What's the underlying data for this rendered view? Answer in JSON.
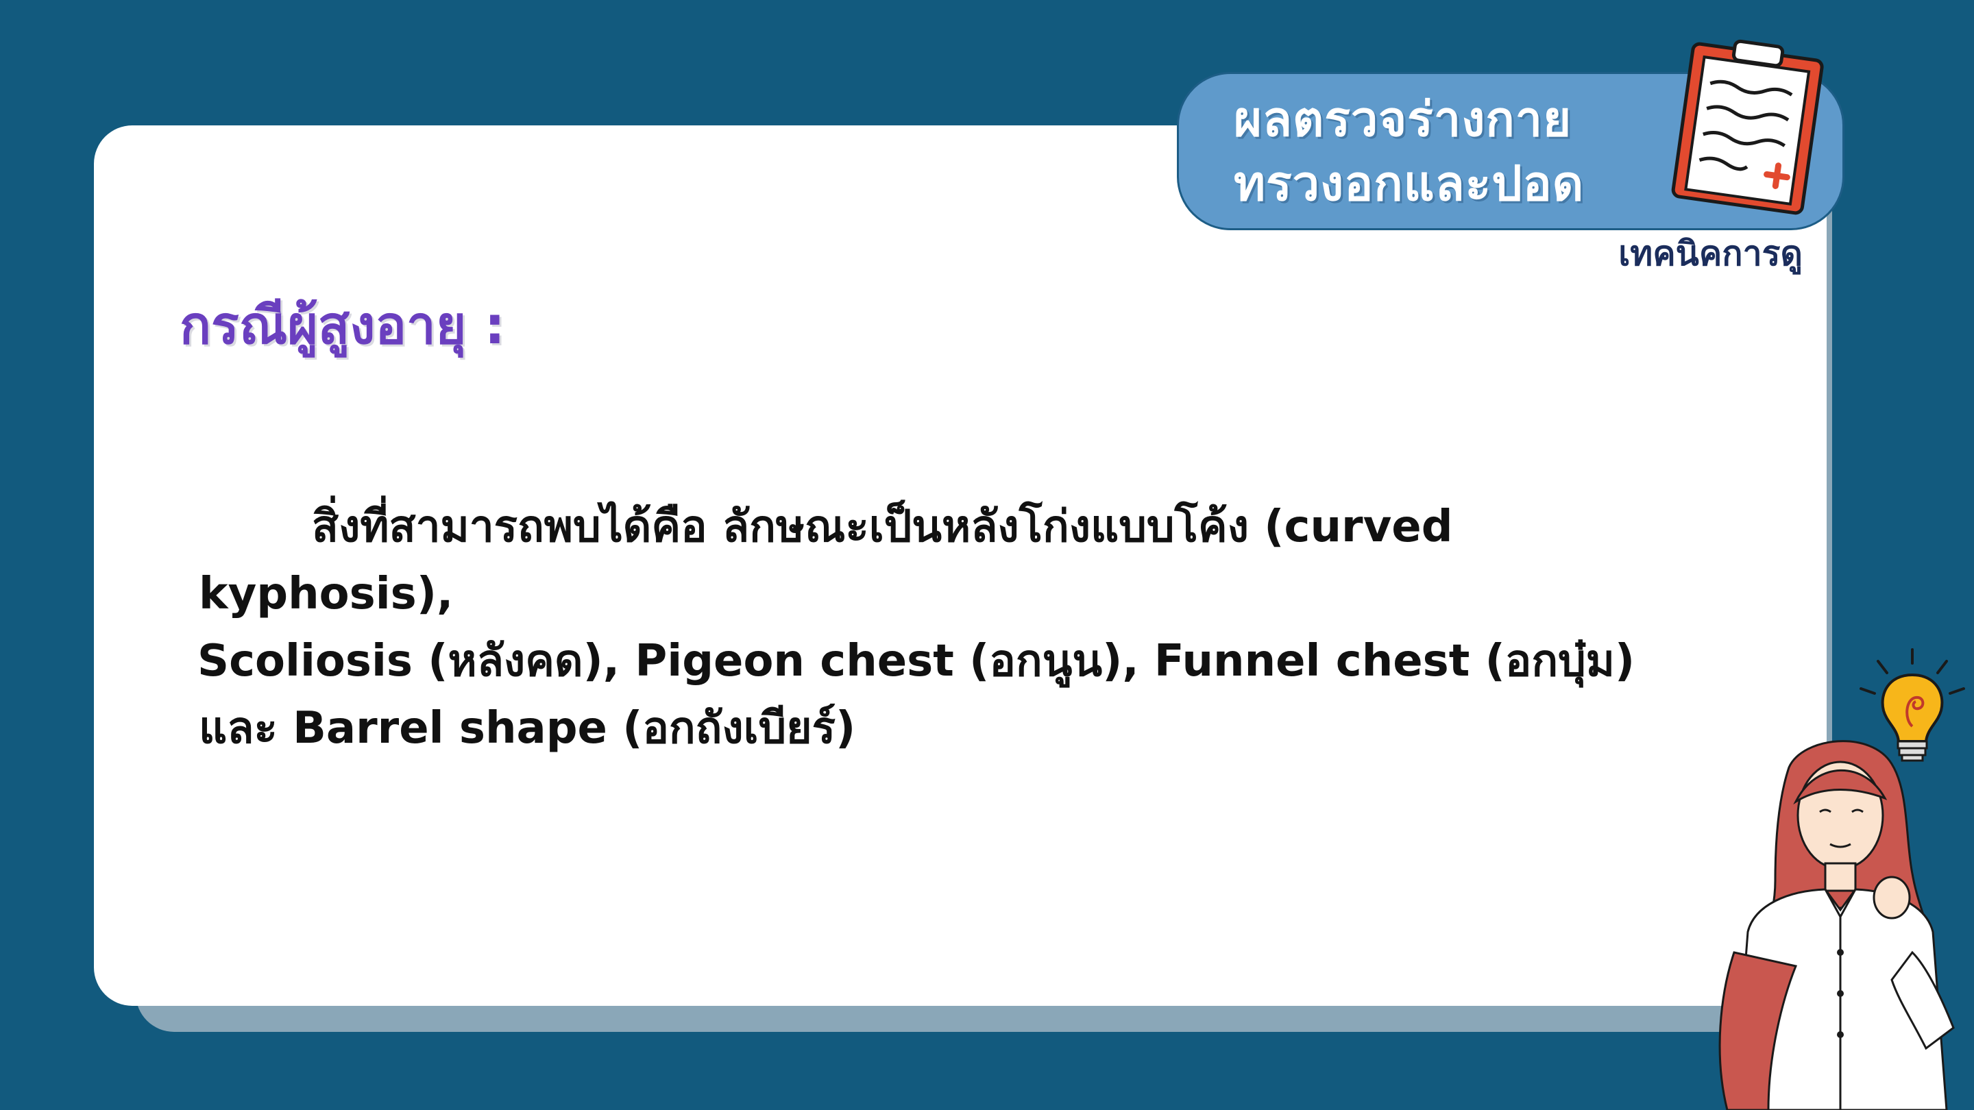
{
  "header": {
    "title_line1": "ผลตรวจร่างกาย",
    "title_line2": "ทรวงอกและปอด",
    "subtitle": "เทคนิคการดู"
  },
  "content": {
    "heading": "กรณีผู้สูงอายุ :",
    "line1": "สิ่งที่สามารถพบได้คือ ลักษณะเป็นหลังโก่งแบบโค้ง (curved kyphosis),",
    "line2": "Scoliosis (หลังคด), Pigeon chest (อกนูน), Funnel chest (อกบุ๋ม)",
    "line3": "และ Barrel shape (อกถังเบียร์)"
  },
  "colors": {
    "background": "#125a7e",
    "card": "#ffffff",
    "title_pill": "#5f9acb",
    "heading": "#6a3fbf",
    "subtitle": "#1b2d5c"
  },
  "icons": {
    "clipboard": "clipboard-icon",
    "bulb": "lightbulb-icon",
    "illustration": "woman-illustration"
  }
}
